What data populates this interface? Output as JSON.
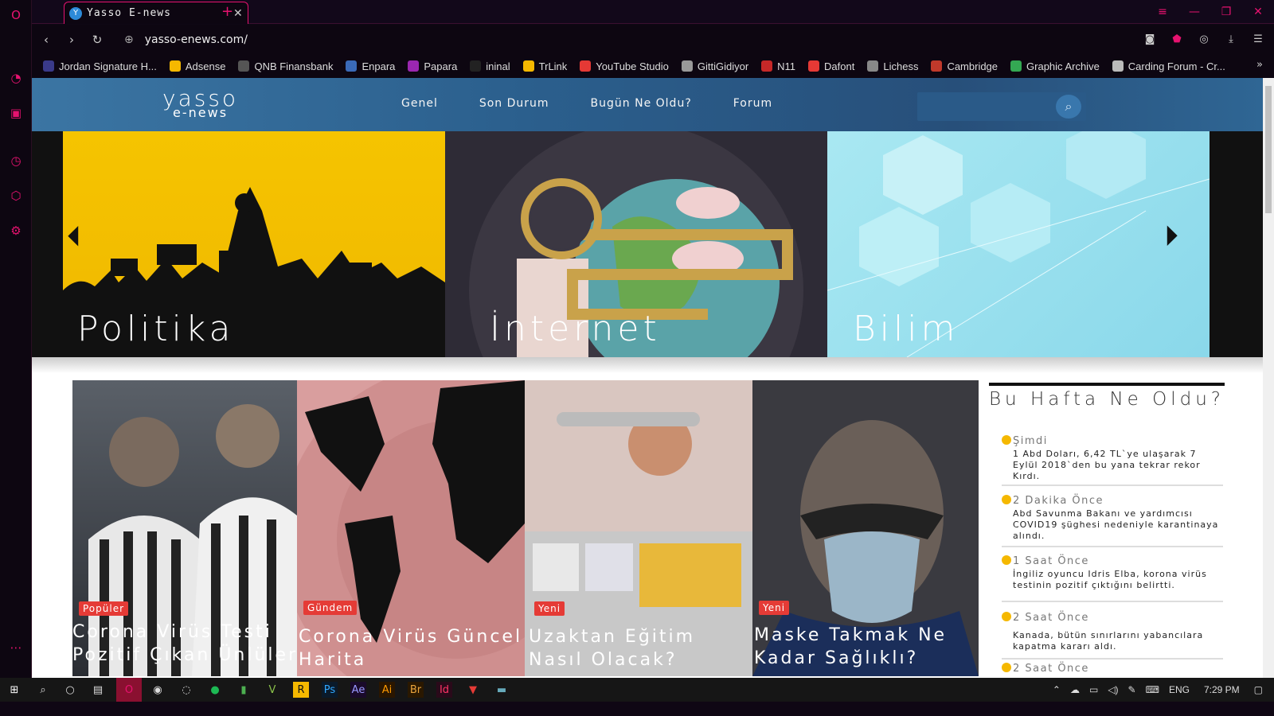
{
  "browser": {
    "tab_title": "Yasso E-news",
    "url": "yasso-enews.com/",
    "bookmarks": [
      "Jordan Signature H...",
      "Adsense",
      "QNB Finansbank",
      "Enpara",
      "Papara",
      "ininal",
      "TrLink",
      "YouTube Studio",
      "GittiGidiyor",
      "N11",
      "Dafont",
      "Lichess",
      "Cambridge",
      "Graphic Archive",
      "Carding Forum - Cr..."
    ]
  },
  "site": {
    "logo_top": "yasso",
    "logo_bottom": "e-news",
    "menu": [
      "Genel",
      "Son Durum",
      "Bugün Ne Oldu?",
      "Forum"
    ],
    "slides": [
      "Politika",
      "İnternet",
      "Bilim"
    ],
    "cards": [
      {
        "badge": "Popüler",
        "title": "Corona Virüs Testi Pozitif Çıkan Ünlüler"
      },
      {
        "badge": "Gündem",
        "title": "Corona Virüs Güncel Harita"
      },
      {
        "badge": "Yeni",
        "title": "Uzaktan Eğitim Nasıl Olacak?"
      },
      {
        "badge": "Yeni",
        "title": "Maske Takmak Ne Kadar Sağlıklı?"
      }
    ],
    "week_title": "Bu Hafta Ne Oldu?",
    "week_items": [
      {
        "time": "Şimdi",
        "text": "1 Abd Doları, 6,42 TL`ye ulaşarak 7 Eylül 2018`den bu yana tekrar rekor Kırdı."
      },
      {
        "time": "2 Dakika Önce",
        "text": "Abd Savunma Bakanı ve yardımcısı COVID19 şüghesi nedeniyle karantinaya alındı."
      },
      {
        "time": "1 Saat Önce",
        "text": "İngiliz oyuncu Idris Elba, korona virüs testinin pozitif çıktığını belirtti."
      },
      {
        "time": "2 Saat Önce",
        "text": "Kanada, bütün sınırlarını yabancılara kapatma kararı aldı."
      },
      {
        "time": "2 Saat Önce",
        "text": ""
      }
    ]
  },
  "taskbar": {
    "lang": "ENG",
    "time": "7:29 PM"
  },
  "colors": {
    "accent": "#e6126f",
    "header": "#2f6694",
    "badge": "#e53b36",
    "dot": "#f5b800"
  }
}
